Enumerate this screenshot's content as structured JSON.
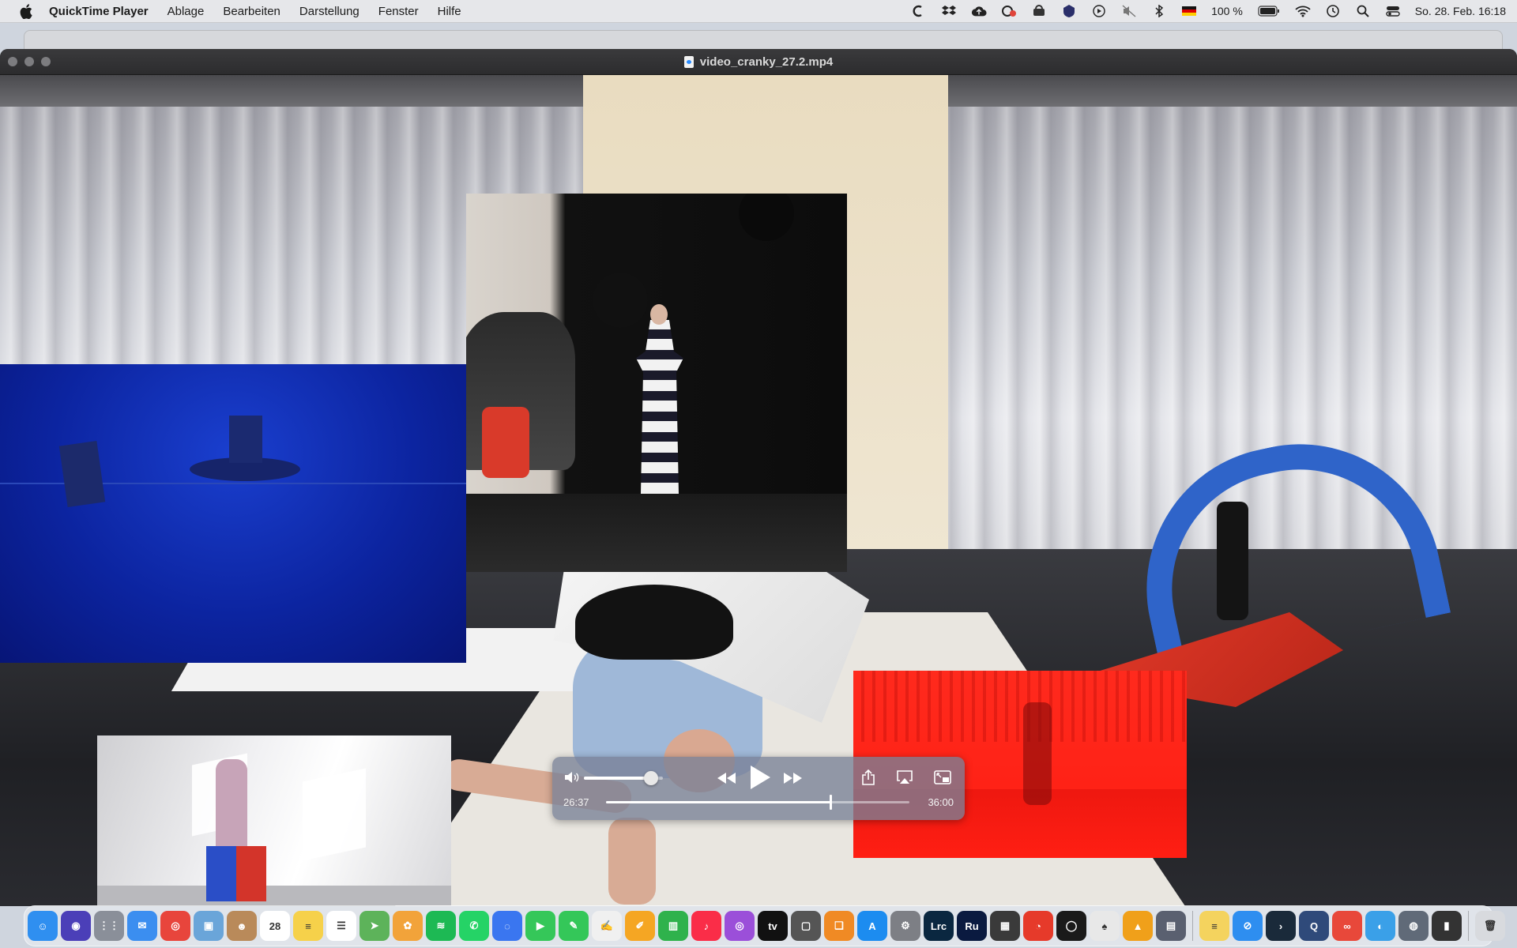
{
  "menubar": {
    "app_name": "QuickTime Player",
    "menus": [
      "Ablage",
      "Bearbeiten",
      "Darstellung",
      "Fenster",
      "Hilfe"
    ],
    "battery_text": "100 %",
    "datetime": "So. 28. Feb.  16:18",
    "status_icons": [
      "creative-cloud-icon",
      "dropbox-icon",
      "cloud-upload-icon",
      "sync-icon",
      "vpn-icon",
      "shield-icon",
      "play-icon",
      "mute-icon",
      "bluetooth-icon",
      "flag-de-icon",
      "battery-icon",
      "wifi-icon",
      "time-machine-icon",
      "search-icon",
      "control-center-icon"
    ]
  },
  "window": {
    "title": "video_cranky_27.2.mp4"
  },
  "player": {
    "current_time": "26:37",
    "total_time": "36:00",
    "progress": 0.739,
    "volume": 0.85
  },
  "dock": {
    "apps": [
      {
        "name": "finder",
        "color": "#2f8ff0",
        "glyph": "☺"
      },
      {
        "name": "siri",
        "color": "#4b3fb8",
        "glyph": "◉"
      },
      {
        "name": "launchpad",
        "color": "#8a8f99",
        "glyph": "⋮⋮"
      },
      {
        "name": "mail",
        "color": "#3b8ef0",
        "glyph": "✉"
      },
      {
        "name": "chrome",
        "color": "#e8453c",
        "glyph": "◎"
      },
      {
        "name": "preview",
        "color": "#6aa5d9",
        "glyph": "▣"
      },
      {
        "name": "contacts",
        "color": "#b98a5a",
        "glyph": "☻"
      },
      {
        "name": "calendar",
        "color": "#ffffff",
        "glyph": "28"
      },
      {
        "name": "notes",
        "color": "#f6d14a",
        "glyph": "≡"
      },
      {
        "name": "reminders",
        "color": "#ffffff",
        "glyph": "☰"
      },
      {
        "name": "maps",
        "color": "#5db35a",
        "glyph": "➤"
      },
      {
        "name": "photos",
        "color": "#f2a33a",
        "glyph": "✿"
      },
      {
        "name": "spotify",
        "color": "#1db954",
        "glyph": "≋"
      },
      {
        "name": "whatsapp",
        "color": "#25d366",
        "glyph": "✆"
      },
      {
        "name": "signal",
        "color": "#3a76f0",
        "glyph": "◌"
      },
      {
        "name": "facetime",
        "color": "#35c759",
        "glyph": "▶"
      },
      {
        "name": "messages",
        "color": "#34c759",
        "glyph": "✎"
      },
      {
        "name": "textedit",
        "color": "#f0f0f0",
        "glyph": "✍"
      },
      {
        "name": "pages",
        "color": "#f5a623",
        "glyph": "✐"
      },
      {
        "name": "numbers",
        "color": "#2fb24c",
        "glyph": "▥"
      },
      {
        "name": "music",
        "color": "#fa2d48",
        "glyph": "♪"
      },
      {
        "name": "podcasts",
        "color": "#9b4fd9",
        "glyph": "◎"
      },
      {
        "name": "apple-tv",
        "color": "#111111",
        "glyph": "tv"
      },
      {
        "name": "screenshot",
        "color": "#555555",
        "glyph": "▢"
      },
      {
        "name": "books",
        "color": "#f08a24",
        "glyph": "❑"
      },
      {
        "name": "app-store",
        "color": "#1c8cf0",
        "glyph": "A"
      },
      {
        "name": "system-preferences",
        "color": "#7d7f85",
        "glyph": "⚙"
      },
      {
        "name": "lightroom-classic",
        "color": "#0a2740",
        "glyph": "Lrc"
      },
      {
        "name": "rush",
        "color": "#0a1a40",
        "glyph": "Ru"
      },
      {
        "name": "calculator",
        "color": "#3a3a3a",
        "glyph": "▦"
      },
      {
        "name": "daisydisk",
        "color": "#e63a2a",
        "glyph": "◔"
      },
      {
        "name": "gyroflow",
        "color": "#1a1a1a",
        "glyph": "◯"
      },
      {
        "name": "poker",
        "color": "#e8e8e8",
        "glyph": "♠"
      },
      {
        "name": "keynote",
        "color": "#f0a01a",
        "glyph": "▲"
      },
      {
        "name": "archive-utility",
        "color": "#5a6070",
        "glyph": "▤"
      },
      {
        "name": "stickies",
        "color": "#f4d35e",
        "glyph": "≡"
      },
      {
        "name": "safari",
        "color": "#2e8ef0",
        "glyph": "⊘"
      },
      {
        "name": "prompt",
        "color": "#1a2a3a",
        "glyph": "›"
      },
      {
        "name": "quicktime",
        "color": "#2f4a7a",
        "glyph": "Q"
      },
      {
        "name": "creative-cloud",
        "color": "#e8483a",
        "glyph": "∞"
      },
      {
        "name": "arc",
        "color": "#3aa0e8",
        "glyph": "◐"
      },
      {
        "name": "image-capture",
        "color": "#606a78",
        "glyph": "◍"
      },
      {
        "name": "video-window",
        "color": "#333333",
        "glyph": "▮"
      },
      {
        "name": "trash",
        "color": "#d8dade",
        "glyph": "🗑"
      }
    ]
  }
}
